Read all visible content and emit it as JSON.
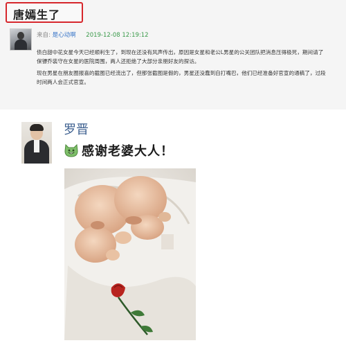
{
  "top_card": {
    "headline": "唐嫣生了",
    "source_label": "来自:",
    "source_name": "是心动啊",
    "datetime": "2019-12-08 12:19:12",
    "paragraphs": [
      "债白甜中花女星今天已经顺利生了，到现在还没有风声传出，原因是女星和老公L男星的公关团队把消息压得极死，期间请了保镖乔装守在女星的医院周围，两人还拒绝了大部分亲朋好友的探访。",
      "现在男星在朋友圈报喜的截图已经流出了，但那张截图是假的，男星还没蠢到自打嘴巴，他们已经准备好官宣的通稿了，过段时间两人会正式官宣。"
    ]
  },
  "bottom_card": {
    "username": "罗晋",
    "post_text": "感谢老婆大人！",
    "emoji_icon": "grinning-cat-emoji-icon",
    "photo_description_icon": "newborn-twins-photo"
  },
  "colors": {
    "headline_border": "#d6262b",
    "username": "#3c5f8f",
    "source_link": "#3a77c9",
    "date": "#3a9a4a"
  }
}
